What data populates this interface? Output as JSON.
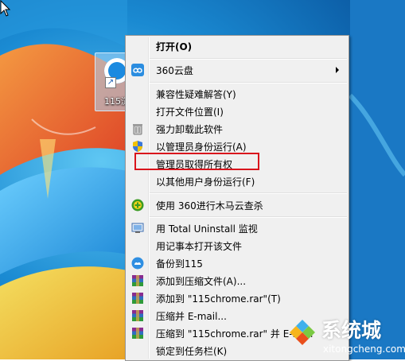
{
  "desktop": {
    "icon_caption": "115浏"
  },
  "menu": {
    "items": [
      {
        "label": "打开(O)",
        "icon": "none",
        "bold": true
      },
      {
        "label": "360云盘",
        "icon": "cloud-disk-icon",
        "submenu": true
      },
      {
        "label": "兼容性疑难解答(Y)",
        "icon": "none"
      },
      {
        "label": "打开文件位置(I)",
        "icon": "none"
      },
      {
        "label": "强力卸载此软件",
        "icon": "trash-icon"
      },
      {
        "label": "以管理员身份运行(A)",
        "icon": "uac-shield-icon"
      },
      {
        "label": "管理员取得所有权",
        "icon": "none"
      },
      {
        "label": "以其他用户身份运行(F)",
        "icon": "none"
      },
      {
        "label": "使用 360进行木马云查杀",
        "icon": "360-scan-icon"
      },
      {
        "label": "用 Total Uninstall 监视",
        "icon": "monitor-icon"
      },
      {
        "label": "用记事本打开该文件",
        "icon": "none"
      },
      {
        "label": "备份到115",
        "icon": "backup-cloud-icon"
      },
      {
        "label": "添加到压缩文件(A)...",
        "icon": "winrar-icon"
      },
      {
        "label": "添加到 \"115chrome.rar\"(T)",
        "icon": "winrar-icon"
      },
      {
        "label": "压缩并 E-mail...",
        "icon": "winrar-icon"
      },
      {
        "label": "压缩到 \"115chrome.rar\" 并 E-mail",
        "icon": "winrar-icon"
      },
      {
        "label": "锁定到任务栏(K)",
        "icon": "none"
      }
    ]
  },
  "watermark": {
    "name": "系统城",
    "url": "xitongcheng.com"
  }
}
